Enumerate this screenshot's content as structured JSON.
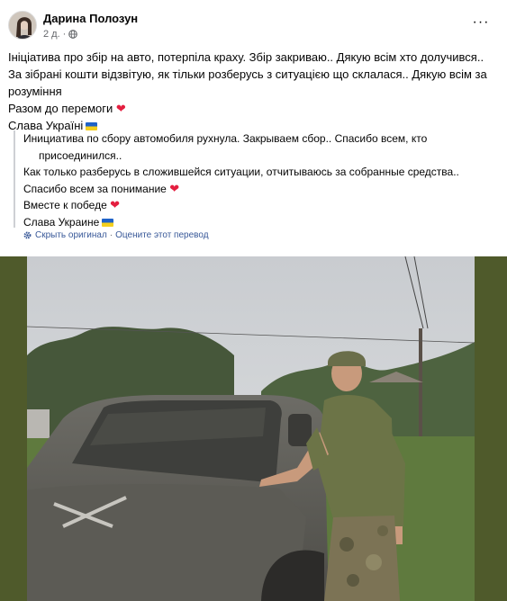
{
  "post": {
    "author": "Дарина Полозун",
    "time": "2 д.",
    "audience_icon": "globe-icon",
    "more_icon": "more-dots-icon",
    "more_label": "···"
  },
  "original": {
    "lines": [
      "Ініціатива про збір на авто, потерпіла краху. Збір закриваю.. Дякую всім хто долучився..",
      "За зібрані кошти відзвітую, як тільки розберусь з ситуацією що склалася.. Дякую всім за",
      "розуміння",
      "Разом до перемоги",
      "Слава Україні"
    ]
  },
  "translation": {
    "lines": [
      "Инициатива по сбору автомобиля рухнула. Закрываем сбор.. Спасибо всем, кто",
      "присоединился..",
      "Как только разберусь в сложившейся ситуации, отчитываюсь за собранные средства..",
      "Спасибо всем за понимание",
      "Вместе к победе",
      "Слава Украине"
    ],
    "hide_original": "Скрыть оригинал",
    "separator": "·",
    "rate_translation": "Оцените этот перевод",
    "settings_icon": "gear-icon"
  },
  "colors": {
    "heart": "#e41e3f",
    "link": "#385898",
    "photo_frame": "#4f5a2b",
    "flag_blue": "#1f62c8",
    "flag_yellow": "#f4cf1d"
  }
}
